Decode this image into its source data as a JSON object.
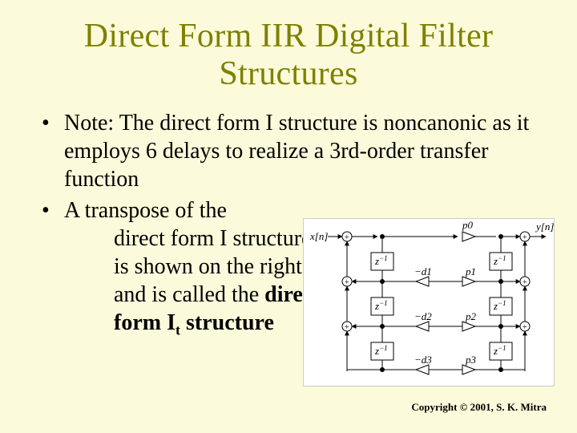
{
  "title": "Direct Form IIR Digital Filter Structures",
  "bullet1": "Note: The direct form I structure is noncanonic as it employs 6 delays to realize a 3rd-order transfer function",
  "bullet2_lead": "A transpose of the",
  "bullet2_line1": "direct form I structure",
  "bullet2_line2": " is shown on the right",
  "bullet2_line3_pre": "and is called the ",
  "bullet2_bold1": "direct",
  "bullet2_bold2": "form I",
  "bullet2_sub_t": "t",
  "bullet2_bold3": "  structure",
  "copyright": "Copyright © 2001, S. K. Mitra",
  "diagram": {
    "input": "x[n]",
    "output": "y[n]",
    "delay": "z",
    "delay_sup": "−1",
    "coeff_d1": "−d1",
    "coeff_d2": "−d2",
    "coeff_d3": "−d3",
    "coeff_p0": "p0",
    "coeff_p1": "p1",
    "coeff_p2": "p2",
    "coeff_p3": "p3"
  }
}
